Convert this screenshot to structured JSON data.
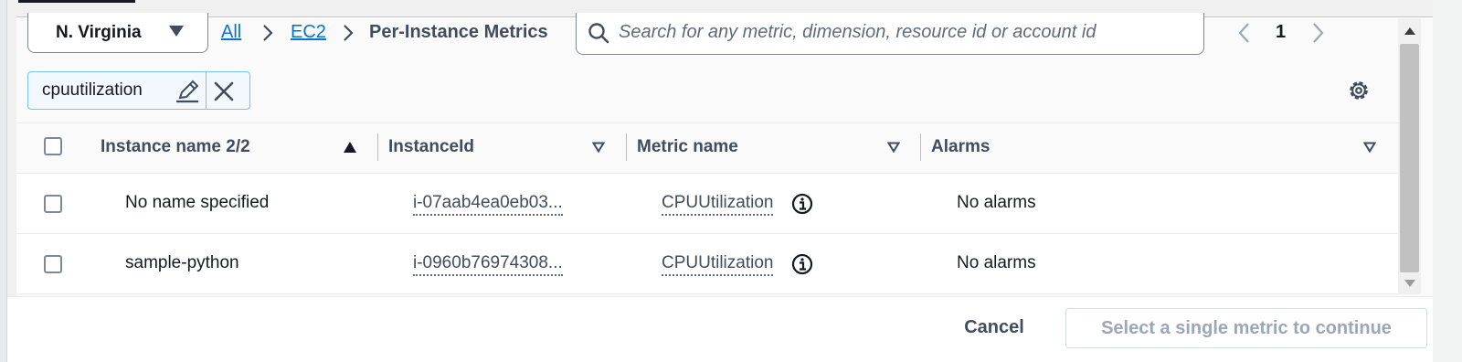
{
  "region": {
    "label": "N. Virginia"
  },
  "breadcrumb": {
    "all": "All",
    "ec2": "EC2",
    "current": "Per-Instance Metrics"
  },
  "search": {
    "placeholder": "Search for any metric, dimension, resource id or account id",
    "value": ""
  },
  "pagination": {
    "page": "1"
  },
  "filter_token": {
    "label": "cpuutilization"
  },
  "table": {
    "columns": [
      {
        "label": "Instance name 2/2",
        "sort": "ascending"
      },
      {
        "label": "InstanceId"
      },
      {
        "label": "Metric name"
      },
      {
        "label": "Alarms"
      }
    ],
    "rows": [
      {
        "instance_name": "No name specified",
        "instance_id": "i-07aab4ea0eb03...",
        "metric_name": "CPUUtilization",
        "alarms": "No alarms"
      },
      {
        "instance_name": "sample-python",
        "instance_id": "i-0960b76974308...",
        "metric_name": "CPUUtilization",
        "alarms": "No alarms"
      }
    ]
  },
  "footer": {
    "cancel_label": "Cancel",
    "continue_label": "Select a single metric to continue"
  },
  "colors": {
    "link": "#0972d3",
    "token_border": "#7cc2ee",
    "token_bg": "#f2f8fd",
    "disabled_text": "#9ba7b6"
  }
}
